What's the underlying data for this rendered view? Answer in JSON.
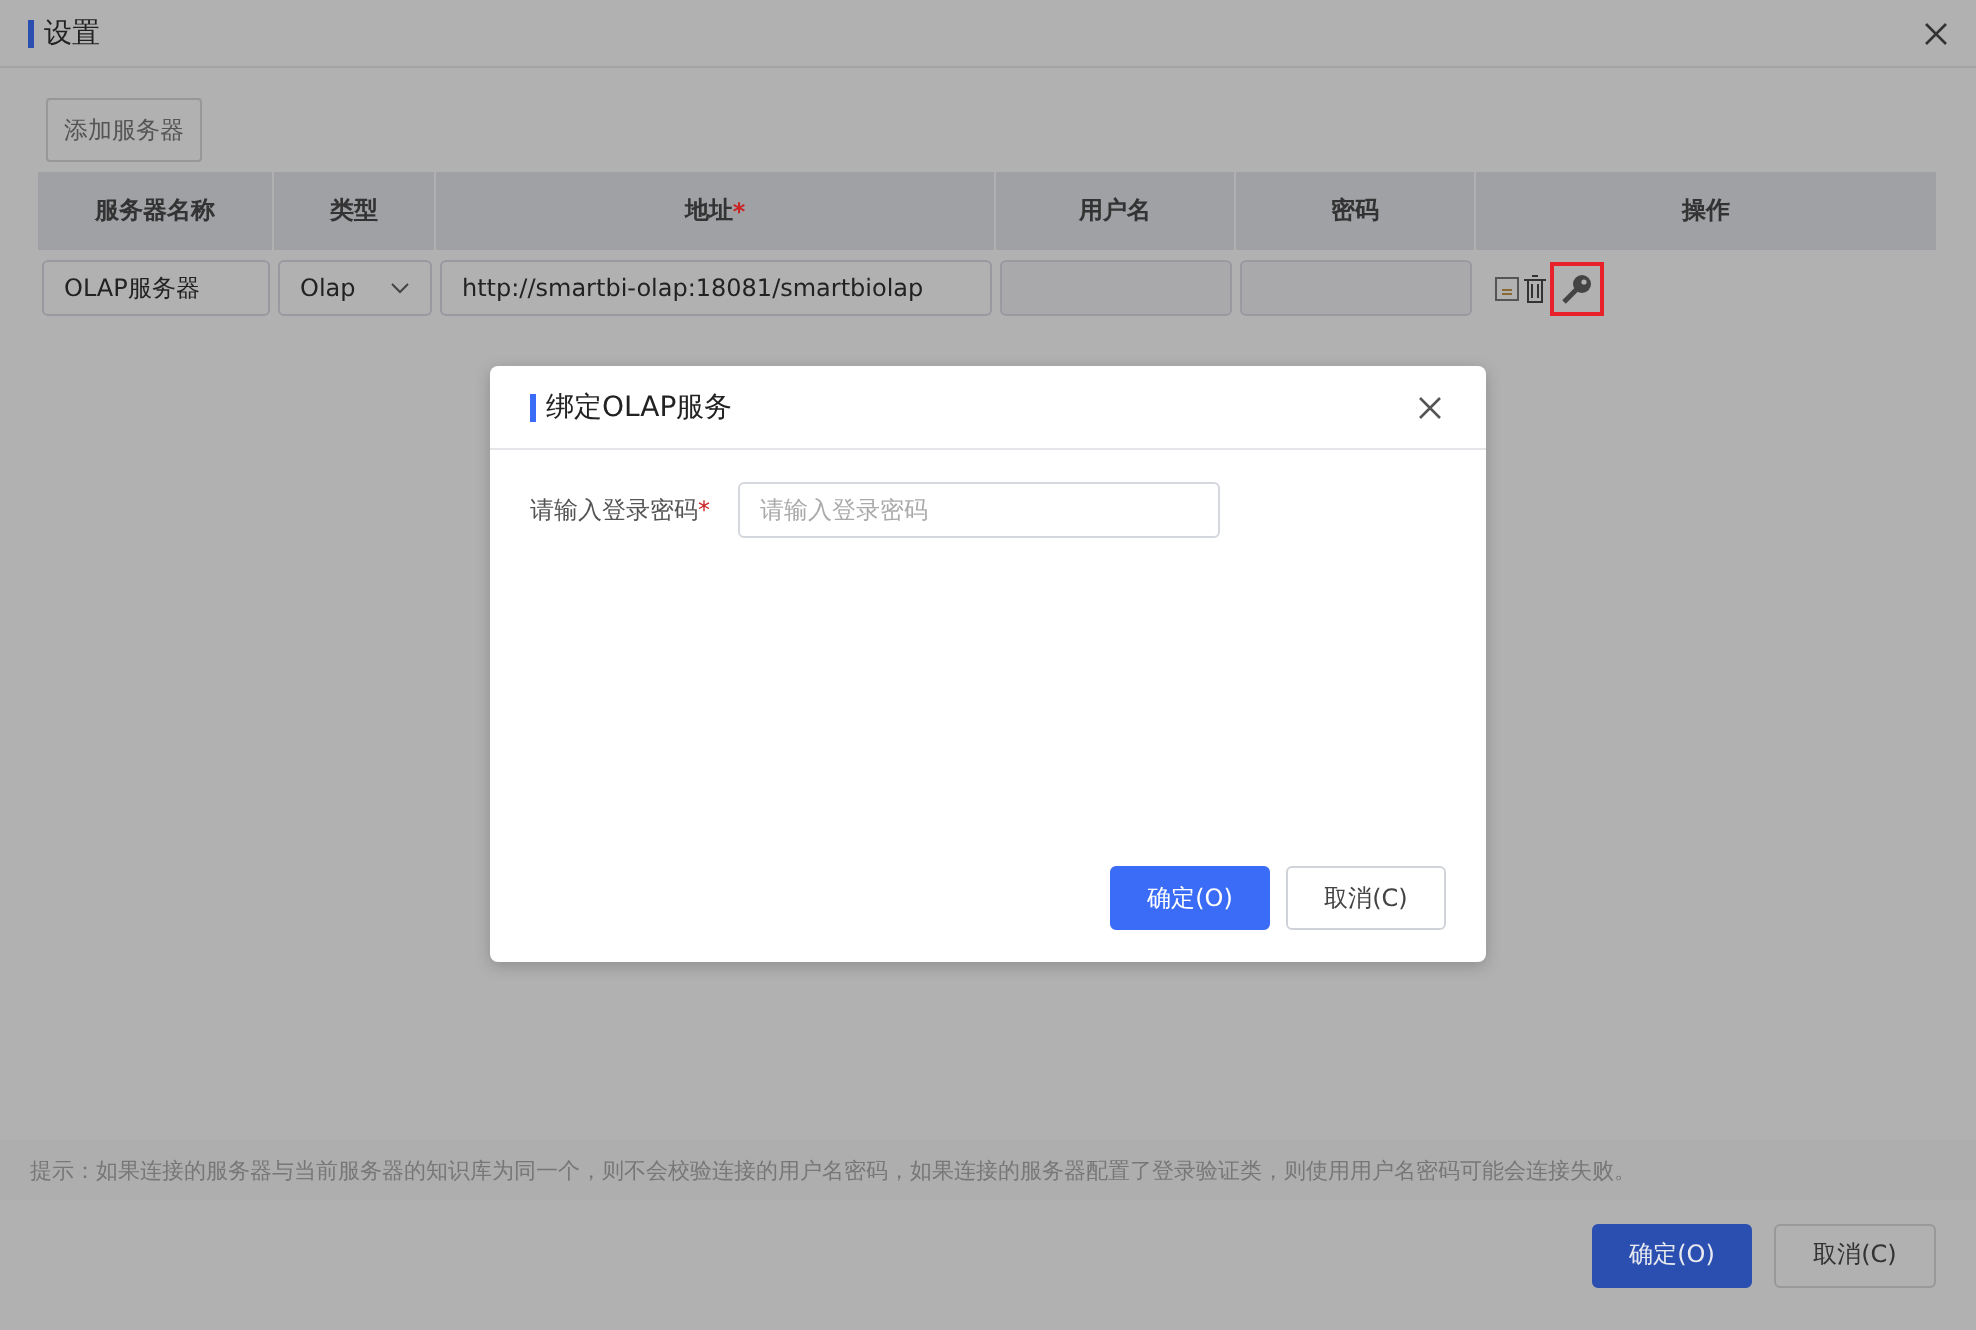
{
  "window": {
    "title": "设置"
  },
  "add_button": "添加服务器",
  "table": {
    "columns": [
      {
        "label": "服务器名称"
      },
      {
        "label": "类型"
      },
      {
        "label": "地址",
        "required_mark": "*"
      },
      {
        "label": "用户名"
      },
      {
        "label": "密码"
      },
      {
        "label": "操作"
      }
    ],
    "rows": [
      {
        "name": "OLAP服务器",
        "type": "Olap",
        "address": "http://smartbi-olap:18081/smartbiolap"
      }
    ]
  },
  "hint": "提示：如果连接的服务器与当前服务器的知识库为同一个，则不会校验连接的用户名密码，如果连接的服务器配置了登录验证类，则使用用户名密码可能会连接失败。",
  "buttons": [
    "确定(O)",
    "取消(C)"
  ],
  "dialog": {
    "title": "绑定OLAP服务",
    "field_label": "请输入登录密码",
    "required_mark": "*",
    "placeholder": "请输入登录密码",
    "buttons": [
      "确定(O)",
      "取消(C)"
    ]
  }
}
